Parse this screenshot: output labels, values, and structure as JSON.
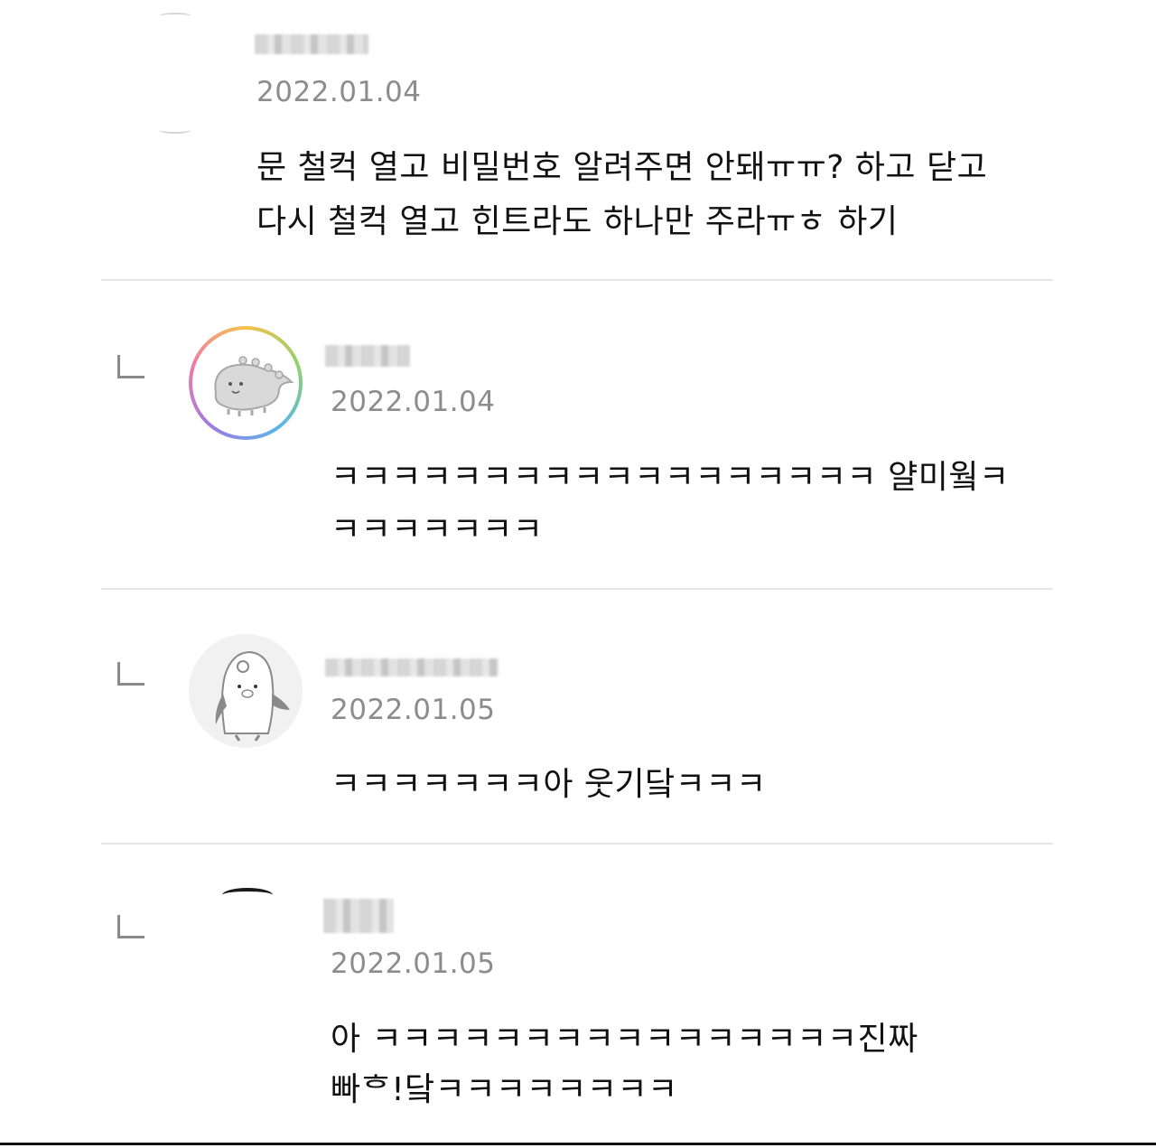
{
  "comments": [
    {
      "date": "2022.01.04",
      "lines": [
        "문 철컥 열고 비밀번호 알려주면 안돼ㅠㅠ? 하고 닫고",
        "다시 철컥 열고 힌트라도 하나만 주라ㅠㅎ 하기"
      ],
      "is_reply": false
    },
    {
      "date": "2022.01.04",
      "lines": [
        "ㅋㅋㅋㅋㅋㅋㅋㅋㅋㅋㅋㅋㅋㅋㅋㅋㅋㅋ   얄미웤ㅋ",
        "ㅋㅋㅋㅋㅋㅋㅋ"
      ],
      "is_reply": true,
      "avatar_icon": "dinosaur-avatar-icon"
    },
    {
      "date": "2022.01.05",
      "lines": [
        "ㅋㅋㅋㅋㅋㅋㅋ아      웃기닼ㅋㅋㅋ"
      ],
      "is_reply": true,
      "avatar_icon": "penguin-avatar-icon"
    },
    {
      "date": "2022.01.05",
      "lines": [
        "아        ㅋㅋㅋㅋㅋㅋㅋㅋㅋㅋㅋㅋㅋㅋㅋㅋ진짜",
        "    빠ᄒ!닼ㅋㅋㅋㅋㅋㅋㅋㅋ"
      ],
      "is_reply": true,
      "avatar_icon": "avatar-icon"
    }
  ],
  "colors": {
    "text": "#111111",
    "date": "#8c8c8c",
    "divider": "#e7e7e7",
    "reply_arrow": "#8a8a8a"
  }
}
